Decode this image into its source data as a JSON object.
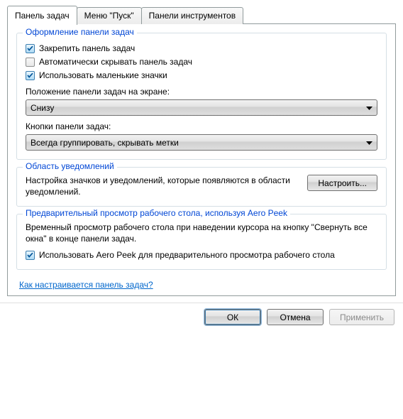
{
  "tabs": {
    "taskbar": "Панель задач",
    "startmenu": "Меню \"Пуск\"",
    "toolbars": "Панели инструментов"
  },
  "appearance": {
    "legend": "Оформление панели задач",
    "lock": "Закрепить панель задач",
    "autohide": "Автоматически скрывать панель задач",
    "smallicons": "Использовать маленькие значки",
    "position_label": "Положение панели задач на экране:",
    "position_value": "Снизу",
    "buttons_label": "Кнопки панели задач:",
    "buttons_value": "Всегда группировать, скрывать метки"
  },
  "notification": {
    "legend": "Область уведомлений",
    "text": "Настройка значков и уведомлений, которые появляются в области уведомлений.",
    "button": "Настроить..."
  },
  "aero": {
    "legend": "Предварительный просмотр рабочего стола, используя Aero Peek",
    "text": "Временный просмотр рабочего стола при наведении курсора на кнопку \"Свернуть все окна\" в конце панели задач.",
    "checkbox": "Использовать Aero Peek для предварительного просмотра рабочего стола"
  },
  "help_link": "Как настраивается панель задач?",
  "buttons": {
    "ok": "ОК",
    "cancel": "Отмена",
    "apply": "Применить"
  }
}
